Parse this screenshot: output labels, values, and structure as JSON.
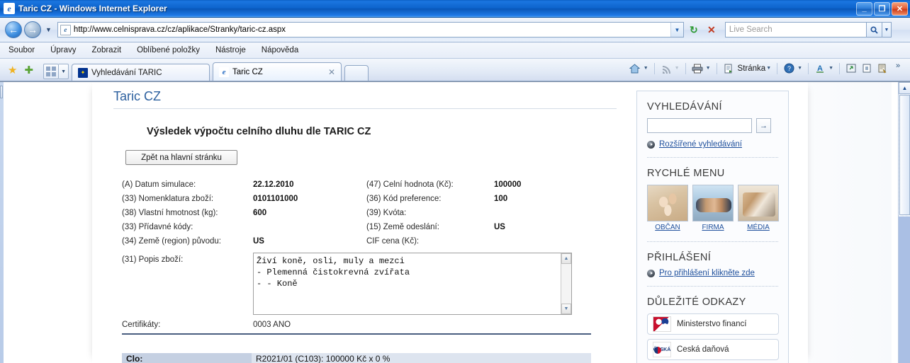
{
  "window": {
    "title": "Taric CZ - Windows Internet Explorer",
    "icon": "ie-logo-icon",
    "minimize": "_",
    "maximize": "❐",
    "close": "✕"
  },
  "addressbar": {
    "back_icon": "back-arrow-icon",
    "forward_icon": "forward-arrow-icon",
    "history_caret": "▼",
    "page_icon": "e",
    "url": "http://www.celnisprava.cz/cz/aplikace/Stranky/taric-cz.aspx",
    "url_dropdown": "▼",
    "refresh_icon": "↻",
    "stop_icon": "✕",
    "search_placeholder": "Live Search",
    "search_value": "",
    "search_go_icon": "🔍",
    "search_caret": "▼"
  },
  "menubar": {
    "items": [
      {
        "label": "Soubor",
        "accel": "S"
      },
      {
        "label": "Úpravy",
        "accel": "p"
      },
      {
        "label": "Zobrazit",
        "accel": "Z"
      },
      {
        "label": "Oblíbené položky",
        "accel": "O"
      },
      {
        "label": "Nástroje",
        "accel": "s"
      },
      {
        "label": "Nápověda",
        "accel": "N"
      }
    ]
  },
  "tabbar": {
    "fav_star_icon": "★",
    "add_fav_icon": "✚",
    "quick_tabs_icon": "grid-icon",
    "quick_tabs_caret": "▼",
    "tabs": [
      {
        "label": "Vyhledávání TARIC",
        "icon": "eu-flag-icon",
        "active": false,
        "close": ""
      },
      {
        "label": "Taric CZ",
        "icon": "ie-logo-icon",
        "active": true,
        "close": "✕"
      }
    ],
    "new_tab_label": "",
    "tools": [
      {
        "name": "home-icon",
        "glyph": "⌂",
        "label": "",
        "caret": "▼"
      },
      {
        "name": "feeds-icon",
        "glyph": "◓",
        "label": "",
        "caret": "▼"
      },
      {
        "name": "print-icon",
        "glyph": "⎙",
        "label": "",
        "caret": "▼"
      },
      {
        "name": "page-icon",
        "glyph": "📄",
        "label": "Stránka",
        "caret": "▼"
      },
      {
        "name": "help-icon",
        "glyph": "?",
        "label": "",
        "caret": "▼"
      },
      {
        "name": "tools-font-icon",
        "glyph": "A",
        "label": "",
        "caret": "▼"
      },
      {
        "name": "fullscreen-icon",
        "glyph": "⛶",
        "label": "",
        "caret": ""
      },
      {
        "name": "readmode-icon",
        "glyph": "▣",
        "label": "",
        "caret": ""
      },
      {
        "name": "research-icon",
        "glyph": "📋",
        "label": "",
        "caret": ""
      }
    ],
    "overflow_icon": "»"
  },
  "page": {
    "site_title": "Taric CZ",
    "result_title": "Výsledek výpočtu celního dluhu dle TARIC CZ",
    "back_button": "Zpět na hlavní stránku",
    "fields": [
      {
        "label": "(A) Datum simulace:",
        "value": "22.12.2010",
        "label2": "(47) Celní hodnota (Kč):",
        "value2": "100000"
      },
      {
        "label": "(33) Nomenklatura zboží:",
        "value": "0101101000",
        "label2": "(36) Kód preference:",
        "value2": "100"
      },
      {
        "label": "(38) Vlastní hmotnost (kg):",
        "value": "600",
        "label2": "(39) Kvóta:",
        "value2": ""
      },
      {
        "label": "(33) Přídavné kódy:",
        "value": "",
        "label2": "(15) Země odeslání:",
        "value2": "US"
      },
      {
        "label": "(34) Země (region) původu:",
        "value": "US",
        "label2": "CIF cena (Kč):",
        "value2": ""
      }
    ],
    "description_label": "(31) Popis zboží:",
    "description_value": "Živí koně, osli, muly a mezci\n- Plemenná čistokrevná zvířata\n- - Koně",
    "scroll_up_icon": "▲",
    "scroll_down_icon": "▼",
    "cert_label": "Certifikáty:",
    "cert_value": "0003 ANO",
    "result_row_header": "Clo:",
    "result_row_value": "R2021/01 (C103): 100000 Kč x 0 %"
  },
  "sidebar": {
    "search": {
      "heading": "VYHLEDÁVÁNÍ",
      "input_value": "",
      "go_icon": "→",
      "advanced_link": "Rozšířené vyhledávání",
      "bullet_icon": "play-bullet-icon"
    },
    "quickmenu": {
      "heading": "RYCHLÉ MENU",
      "items": [
        {
          "label": "OBČAN",
          "image": "family-photo"
        },
        {
          "label": "FIRMA",
          "image": "handshake-photo"
        },
        {
          "label": "MÉDIA",
          "image": "pen-writing-photo"
        }
      ]
    },
    "login": {
      "heading": "PŘIHLÁŠENÍ",
      "link": "Pro přihlášení klikněte zde",
      "bullet_icon": "play-bullet-icon"
    },
    "links": {
      "heading": "DŮLEŽITÉ ODKAZY",
      "items": [
        {
          "label": "Ministerstvo financí",
          "logo": "czech-coat-of-arms-icon"
        },
        {
          "label": "Česká daňová",
          "logo": "czech-tax-admin-icon"
        }
      ]
    }
  },
  "scrollbar": {
    "up_icon": "▲",
    "down_icon": "▼"
  },
  "colors": {
    "title_blue": "#0d63cc",
    "link_blue": "#1e4f9c",
    "heading_blue": "#2b5f9e",
    "rule_dark": "#4a5e80"
  }
}
